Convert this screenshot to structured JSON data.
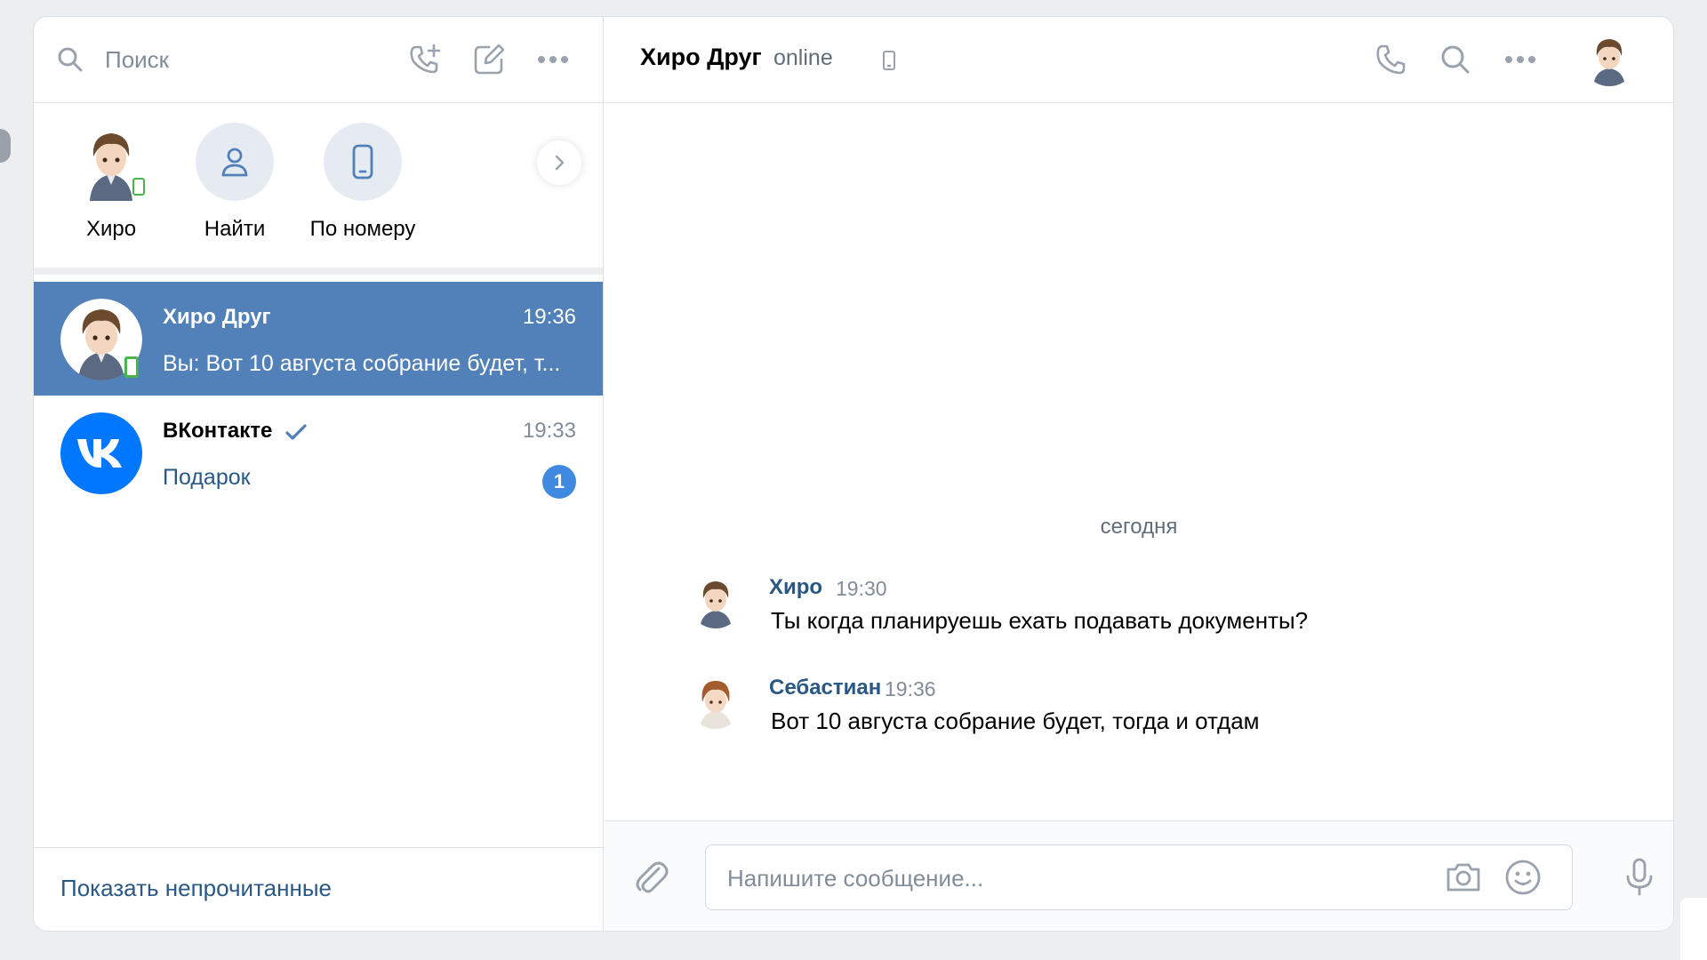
{
  "left_panel": {
    "search": {
      "placeholder": "Поиск"
    },
    "quick_actions": [
      {
        "label": "Хиро"
      },
      {
        "label": "Найти"
      },
      {
        "label": "По номеру"
      }
    ],
    "chats": [
      {
        "name": "Хиро Друг",
        "time": "19:36",
        "message": "Вы: Вот 10 августа собрание будет, т...",
        "active": true
      },
      {
        "name": "ВКонтакте",
        "time": "19:33",
        "message": "Подарок",
        "unread": "1",
        "verified": true
      }
    ],
    "show_unread_label": "Показать непрочитанные"
  },
  "chat": {
    "peer_name": "Хиро Друг",
    "peer_status": "online",
    "date_separator": "сегодня",
    "messages": [
      {
        "author": "Хиро",
        "time": "19:30",
        "text": "Ты когда планируешь ехать подавать документы?"
      },
      {
        "author": "Себастиан",
        "time": "19:36",
        "text": "Вот 10 августа собрание будет, тогда и отдам"
      }
    ],
    "composer": {
      "placeholder": "Напишите сообщение..."
    }
  },
  "colors": {
    "accent": "#5181b8",
    "link": "#2a5885",
    "badge": "#3f8ae0",
    "icon": "#99a2ad",
    "online": "#4bb34b"
  },
  "icons": [
    "search-icon",
    "add-call-icon",
    "compose-icon",
    "more-icon",
    "user-icon",
    "phone-device-icon",
    "chevron-right-icon",
    "verified-icon",
    "call-icon",
    "attach-icon",
    "camera-icon",
    "smile-icon",
    "mic-icon"
  ]
}
